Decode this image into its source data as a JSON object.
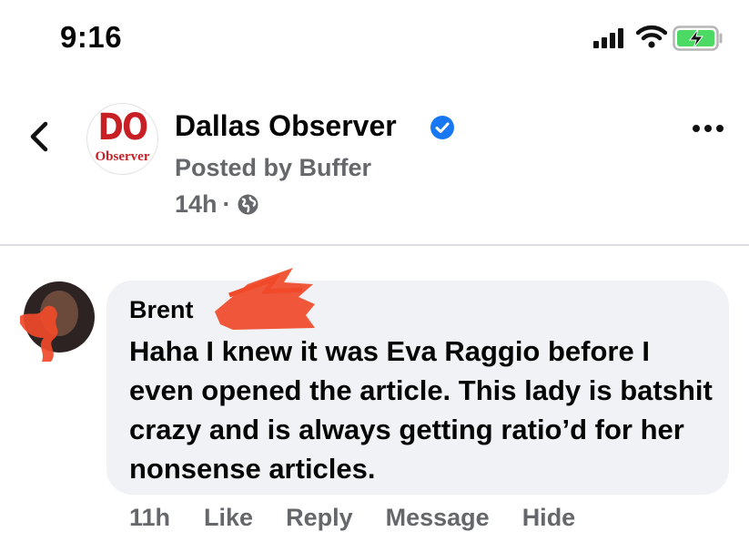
{
  "status_bar": {
    "time": "9:16",
    "icons": [
      "cellular-signal-icon",
      "wifi-icon",
      "battery-charging-icon"
    ],
    "battery_color": "#4cd964"
  },
  "post_header": {
    "page_name": "Dallas Observer",
    "posted_by": "Posted by Buffer",
    "age": "14h",
    "separator": "·",
    "logo": {
      "top_text": "DO",
      "bottom_text": "Observer",
      "color": "#c81f25"
    },
    "verified_color": "#1877f2",
    "more_label": "•••"
  },
  "comment": {
    "author": "Brent",
    "text": "Haha I knew it was Eva Raggio before I even opened the article. This lady is batshit crazy and is always getting ratio’d for her nonsense articles.",
    "redaction_color": "#f04a2a"
  },
  "comment_actions": {
    "age": "11h",
    "like": "Like",
    "reply": "Reply",
    "message": "Message",
    "hide": "Hide"
  },
  "colors": {
    "text_primary": "#050505",
    "text_secondary": "#65676b",
    "bubble_bg": "#f0f2f5"
  }
}
